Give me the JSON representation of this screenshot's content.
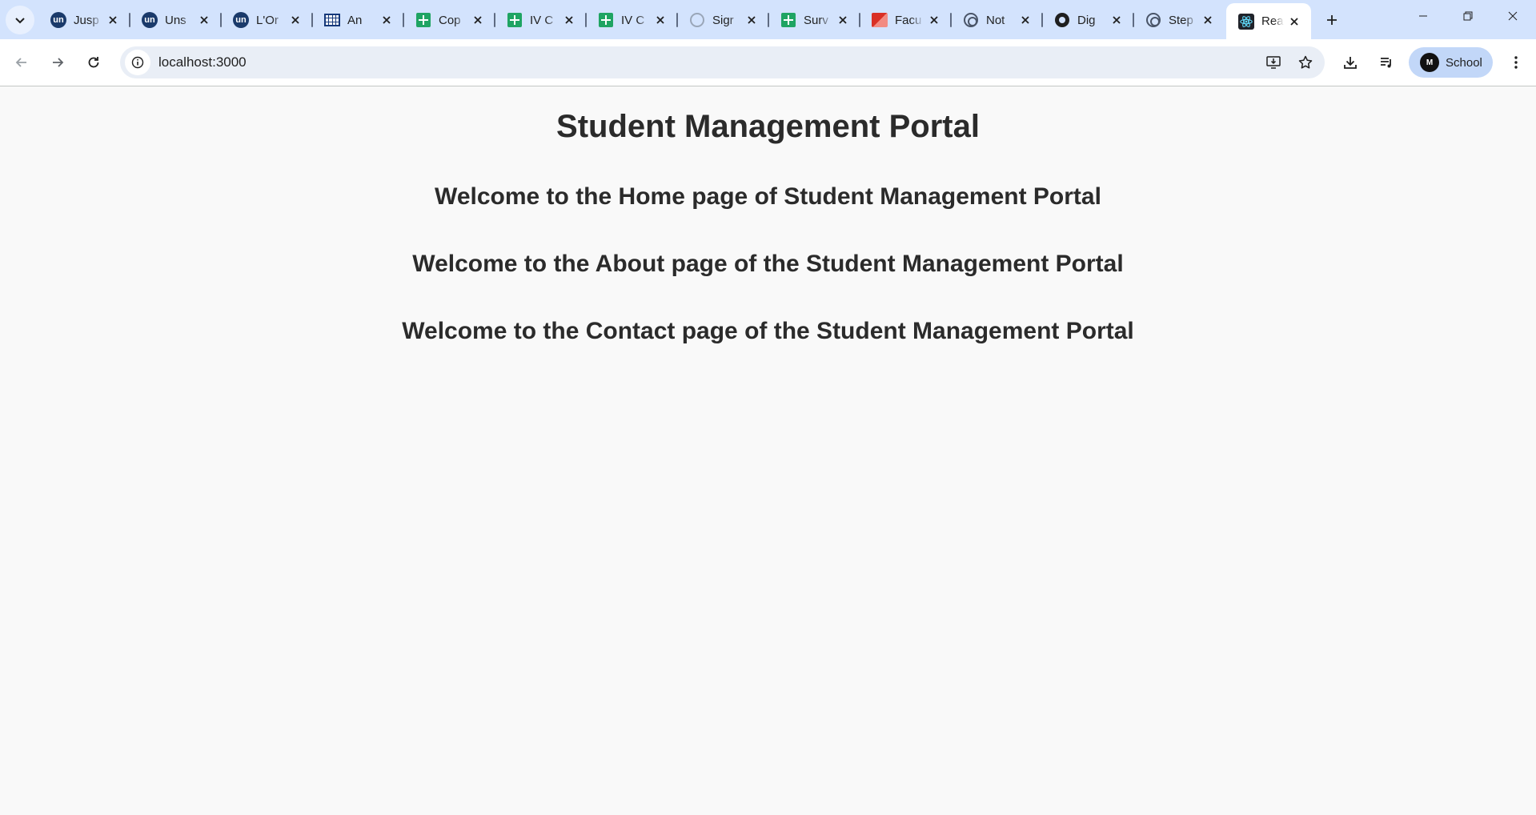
{
  "browser": {
    "tabs": [
      {
        "title": "Jusp",
        "favicon": "unstop-icon"
      },
      {
        "title": "Uns",
        "favicon": "unstop-icon"
      },
      {
        "title": "L'Or",
        "favicon": "unstop-icon"
      },
      {
        "title": "An",
        "favicon": "ieee-icon"
      },
      {
        "title": "Cop",
        "favicon": "sheets-icon"
      },
      {
        "title": "IV C",
        "favicon": "sheets-icon"
      },
      {
        "title": "IV C",
        "favicon": "sheets-icon"
      },
      {
        "title": "Sigr",
        "favicon": "globe-icon"
      },
      {
        "title": "Surv",
        "favicon": "sheets-icon"
      },
      {
        "title": "Facu",
        "favicon": "red-doc-icon"
      },
      {
        "title": "Not",
        "favicon": "openai-icon"
      },
      {
        "title": "Dig",
        "favicon": "github-icon"
      },
      {
        "title": "Step",
        "favicon": "openai-icon"
      },
      {
        "title": "Rea",
        "favicon": "react-icon",
        "active": true
      }
    ],
    "url": "localhost:3000",
    "profile_label": "School",
    "profile_avatar": "M"
  },
  "page": {
    "title": "Student Management Portal",
    "home_text": "Welcome to the Home page of Student Management Portal",
    "about_text": "Welcome to the About page of the Student Management Portal",
    "contact_text": "Welcome to the Contact page of the Student Management Portal"
  }
}
